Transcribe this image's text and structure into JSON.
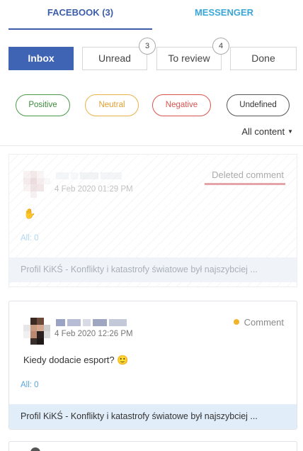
{
  "tabs": [
    {
      "label": "FACEBOOK (3)"
    },
    {
      "label": "MESSENGER"
    }
  ],
  "filters": {
    "inbox": {
      "label": "Inbox"
    },
    "unread": {
      "label": "Unread",
      "count": "3"
    },
    "to_review": {
      "label": "To review",
      "count": "4"
    },
    "done": {
      "label": "Done"
    }
  },
  "sentiments": [
    {
      "label": "Positive",
      "color": "#4a9a4a"
    },
    {
      "label": "Neutral",
      "color": "#e8b24a"
    },
    {
      "label": "Negative",
      "color": "#d9534f"
    },
    {
      "label": "Undefined",
      "color": "#555555"
    }
  ],
  "content_filter": {
    "label": "All content"
  },
  "posts": [
    {
      "status": "Deleted comment",
      "time": "4 Feb 2020 01:29 PM",
      "message": "✋",
      "all_count": "All: 0",
      "source": "Profil KiKŚ - Konflikty i katastrofy światowe był najszybciej ..."
    },
    {
      "type": "Comment",
      "time": "4 Feb 2020 12:26 PM",
      "message": "Kiedy dodacie esport? 🙂",
      "all_count": "All: 0",
      "source": "Profil KiKŚ - Konflikty i katastrofy światowe był najszybciej ..."
    }
  ],
  "colors": {
    "facebook_blue": "#3b5da8",
    "messenger_blue": "#3ba6d9",
    "comment_dot": "#f0b429",
    "deleted_underline": "#e5a5a8"
  }
}
